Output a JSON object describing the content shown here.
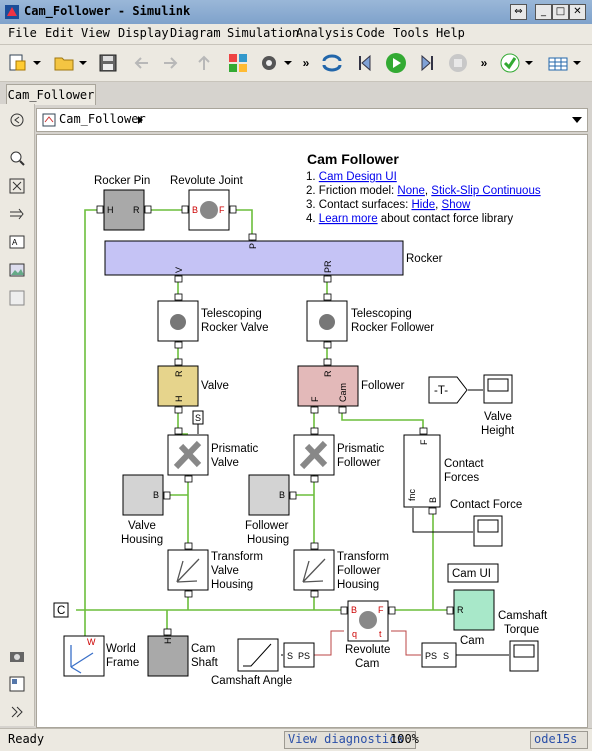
{
  "window": {
    "title": "Cam_Follower - Simulink"
  },
  "menu": [
    "File",
    "Edit",
    "View",
    "Display",
    "Diagram",
    "Simulation",
    "Analysis",
    "Code",
    "Tools",
    "Help"
  ],
  "tab": {
    "label": "Cam_Follower"
  },
  "address": {
    "path": "Cam_Follower"
  },
  "status": {
    "left": "Ready",
    "diagnostics": "View diagnostics",
    "zoom": "100%",
    "solver": "ode15s"
  },
  "annotation": {
    "title": "Cam Follower",
    "items": [
      {
        "num": "1.",
        "link1": "Cam Design UI"
      },
      {
        "num": "2.",
        "text": "Friction model: ",
        "link1": "None",
        "sep": ", ",
        "link2": "Stick-Slip Continuous"
      },
      {
        "num": "3.",
        "text": "Contact surfaces: ",
        "link1": "Hide",
        "sep": ", ",
        "link2": "Show"
      },
      {
        "num": "4.",
        "link1": "Learn more",
        "text": " about contact force library"
      }
    ]
  },
  "blocks": {
    "rocker_pin": "Rocker Pin",
    "revolute_joint": "Revolute Joint",
    "rocker": "Rocker",
    "tel_valve_1": "Telescoping",
    "tel_valve_2": "Rocker Valve",
    "tel_follower_1": "Telescoping",
    "tel_follower_2": "Rocker Follower",
    "valve": "Valve",
    "follower": "Follower",
    "prismatic_valve_1": "Prismatic",
    "prismatic_valve_2": "Valve",
    "prismatic_follower_1": "Prismatic",
    "prismatic_follower_2": "Follower",
    "valve_housing_1": "Valve",
    "valve_housing_2": "Housing",
    "follower_housing_1": "Follower",
    "follower_housing_2": "Housing",
    "tvh_1": "Transform",
    "tvh_2": "Valve",
    "tvh_3": "Housing",
    "tfh_1": "Transform",
    "tfh_2": "Follower",
    "tfh_3": "Housing",
    "goto_tag": "-T-",
    "valve_height_1": "Valve",
    "valve_height_2": "Height",
    "contact_forces_1": "Contact",
    "contact_forces_2": "Forces",
    "contact_force": "Contact Force",
    "cam_ui": "Cam UI",
    "cam": "Cam",
    "camshaft_torque_1": "Camshaft",
    "camshaft_torque_2": "Torque",
    "world_frame_1": "World",
    "world_frame_2": "Frame",
    "cam_shaft_1": "Cam",
    "cam_shaft_2": "Shaft",
    "revolute_cam_1": "Revolute",
    "revolute_cam_2": "Cam",
    "camshaft_angle": "Camshaft Angle",
    "c_port": "C",
    "s_port": "S",
    "ps_s": "PS",
    "s_ps": "S",
    "ps_label": "PS",
    "s_label": "S"
  },
  "ports": {
    "H": "H",
    "R": "R",
    "B": "B",
    "F": "F",
    "P": "P",
    "V": "V",
    "PR": "PR",
    "Cam": "Cam",
    "W": "W",
    "t": "t",
    "q": "q",
    "fnc": "fnc"
  },
  "colors": {
    "rocker_fill": "#c5c3f5",
    "valve_fill": "#e6d48c",
    "follower_fill": "#e3b9b9",
    "cam_fill": "#a8e8c9",
    "grey_block": "#a9a9a9",
    "wire": "#6cbe3c"
  }
}
